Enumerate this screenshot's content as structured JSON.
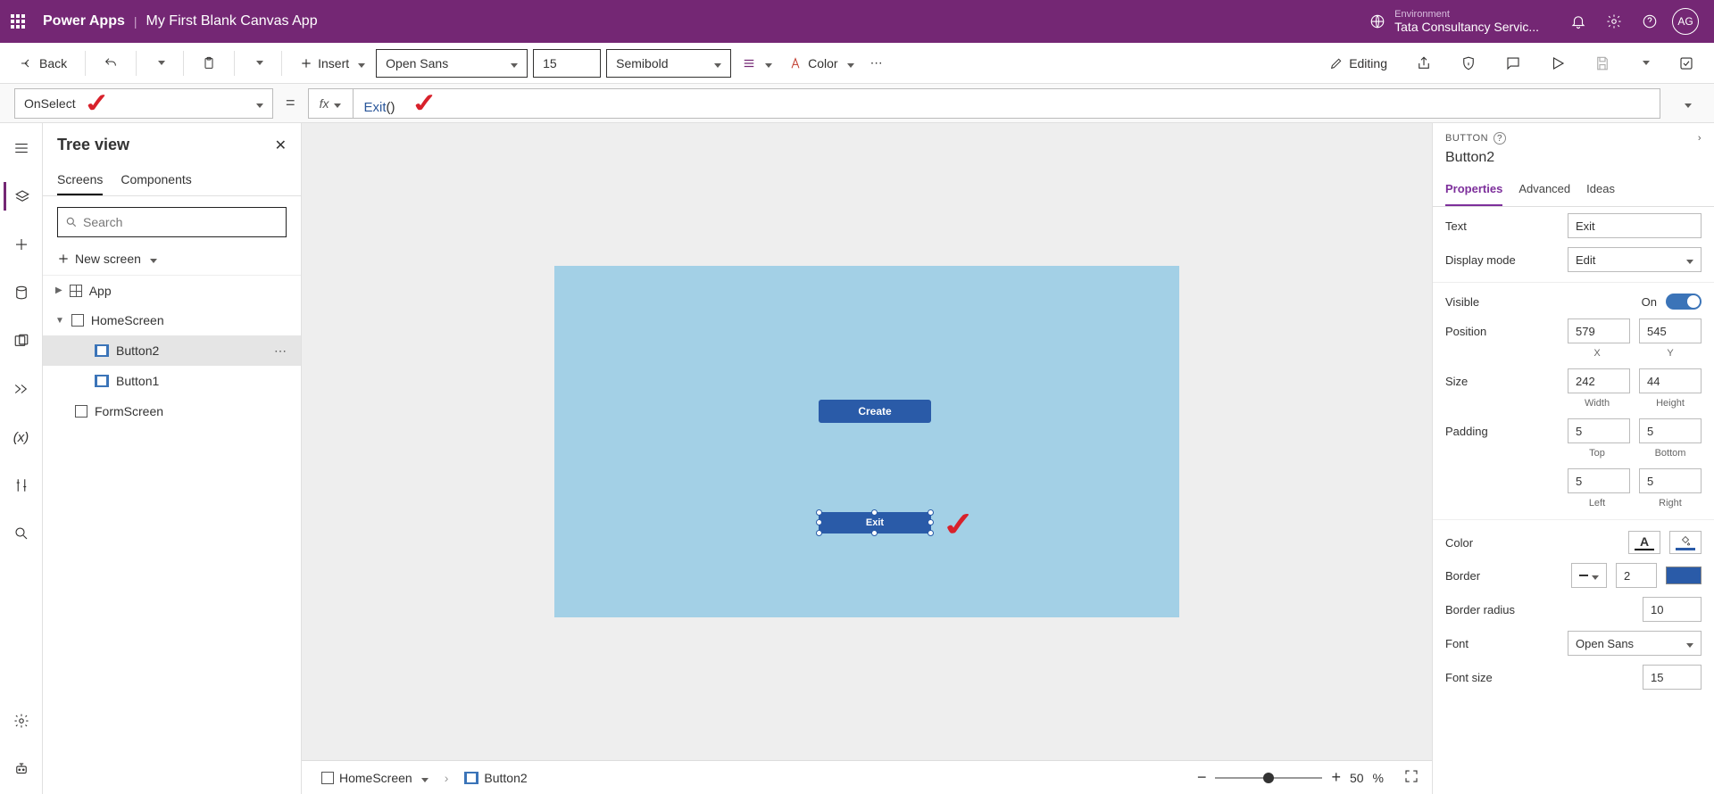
{
  "header": {
    "app": "Power Apps",
    "title": "My First Blank Canvas App",
    "env_label": "Environment",
    "env_name": "Tata Consultancy Servic...",
    "avatar": "AG"
  },
  "ribbon": {
    "back": "Back",
    "insert": "Insert",
    "font": "Open Sans",
    "font_size": "15",
    "weight": "Semibold",
    "color": "Color",
    "editing": "Editing"
  },
  "formula": {
    "property": "OnSelect",
    "fx": "fx",
    "expr_fn": "Exit",
    "expr_rest": "()"
  },
  "tree": {
    "title": "Tree view",
    "tab_screens": "Screens",
    "tab_components": "Components",
    "search_ph": "Search",
    "new_screen": "New screen",
    "node_app": "App",
    "node_home": "HomeScreen",
    "node_btn2": "Button2",
    "node_btn1": "Button1",
    "node_form": "FormScreen"
  },
  "canvas": {
    "create_label": "Create",
    "exit_label": "Exit",
    "bc_screen": "HomeScreen",
    "bc_button": "Button2",
    "zoom": "50",
    "zoom_unit": "%"
  },
  "props": {
    "type": "Button",
    "help": "?",
    "name": "Button2",
    "tab_props": "Properties",
    "tab_adv": "Advanced",
    "tab_ideas": "Ideas",
    "text_lbl": "Text",
    "text_val": "Exit",
    "mode_lbl": "Display mode",
    "mode_val": "Edit",
    "visible_lbl": "Visible",
    "visible_val": "On",
    "pos_lbl": "Position",
    "pos_x": "579",
    "pos_y": "545",
    "lbl_x": "X",
    "lbl_y": "Y",
    "size_lbl": "Size",
    "size_w": "242",
    "size_h": "44",
    "lbl_w": "Width",
    "lbl_h": "Height",
    "pad_lbl": "Padding",
    "pad_t": "5",
    "pad_b": "5",
    "lbl_t": "Top",
    "lbl_b": "Bottom",
    "pad_l": "5",
    "pad_r": "5",
    "lbl_l": "Left",
    "lbl_r": "Right",
    "color_lbl": "Color",
    "border_lbl": "Border",
    "border_val": "2",
    "radius_lbl": "Border radius",
    "radius_val": "10",
    "font_lbl": "Font",
    "font_val": "Open Sans",
    "fsize_lbl": "Font size",
    "fsize_val": "15"
  }
}
